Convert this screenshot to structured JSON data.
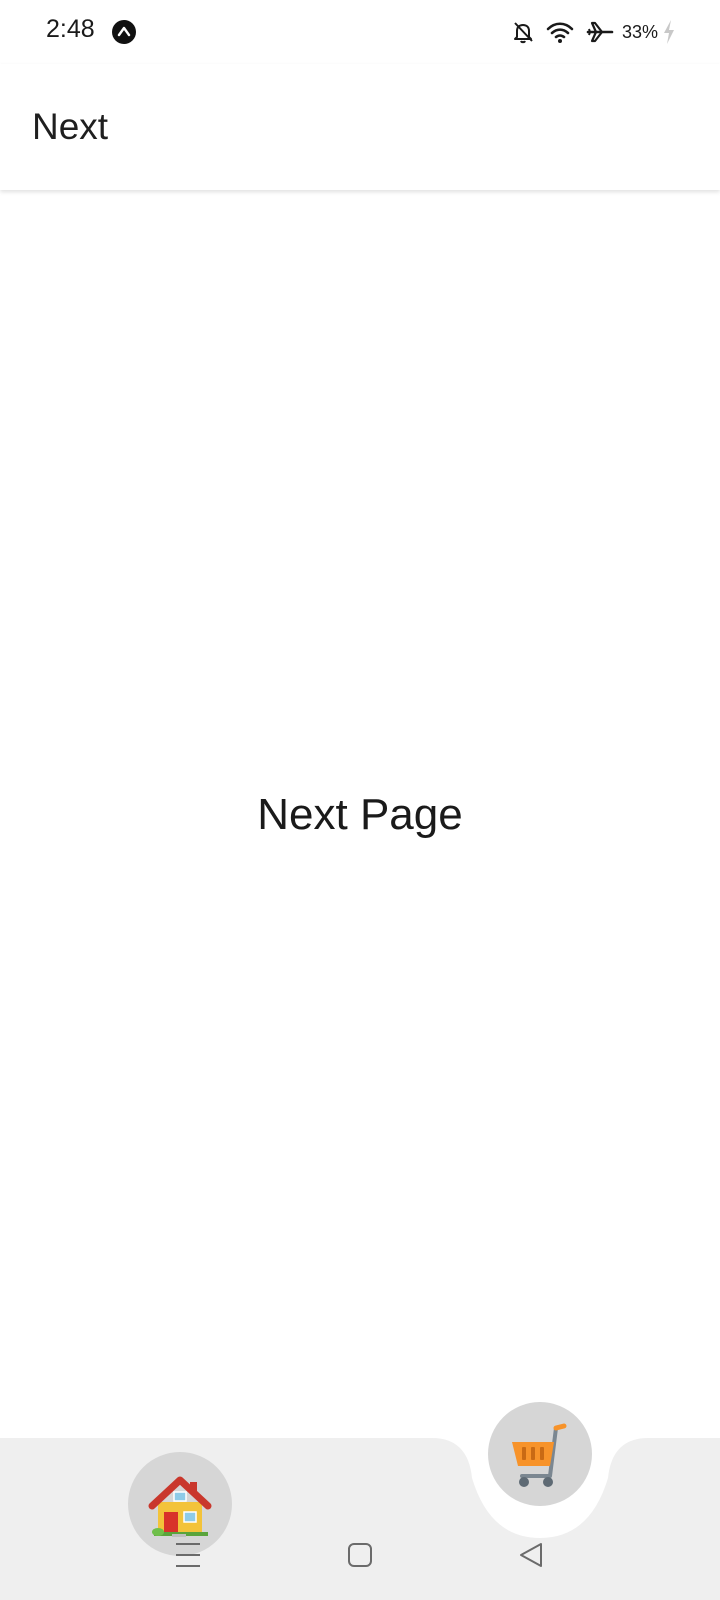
{
  "status_bar": {
    "time": "2:48",
    "app_icon": "up-arrow-badge-icon",
    "icons": [
      "bell-off-icon",
      "wifi-icon",
      "airplane-icon"
    ],
    "battery_percent": "33%",
    "battery_icon": "charging-bolt-icon"
  },
  "app_bar": {
    "title": "Next"
  },
  "main": {
    "center_text": "Next Page"
  },
  "bottom_nav": {
    "background_color": "#efefef",
    "button_color": "#d6d6d6",
    "items": [
      {
        "icon": "house-icon",
        "selected": false
      },
      {
        "icon": "shopping-cart-icon",
        "selected": true
      }
    ]
  },
  "system_nav": {
    "buttons": [
      "recents-menu-icon",
      "home-square-icon",
      "back-triangle-icon"
    ]
  }
}
